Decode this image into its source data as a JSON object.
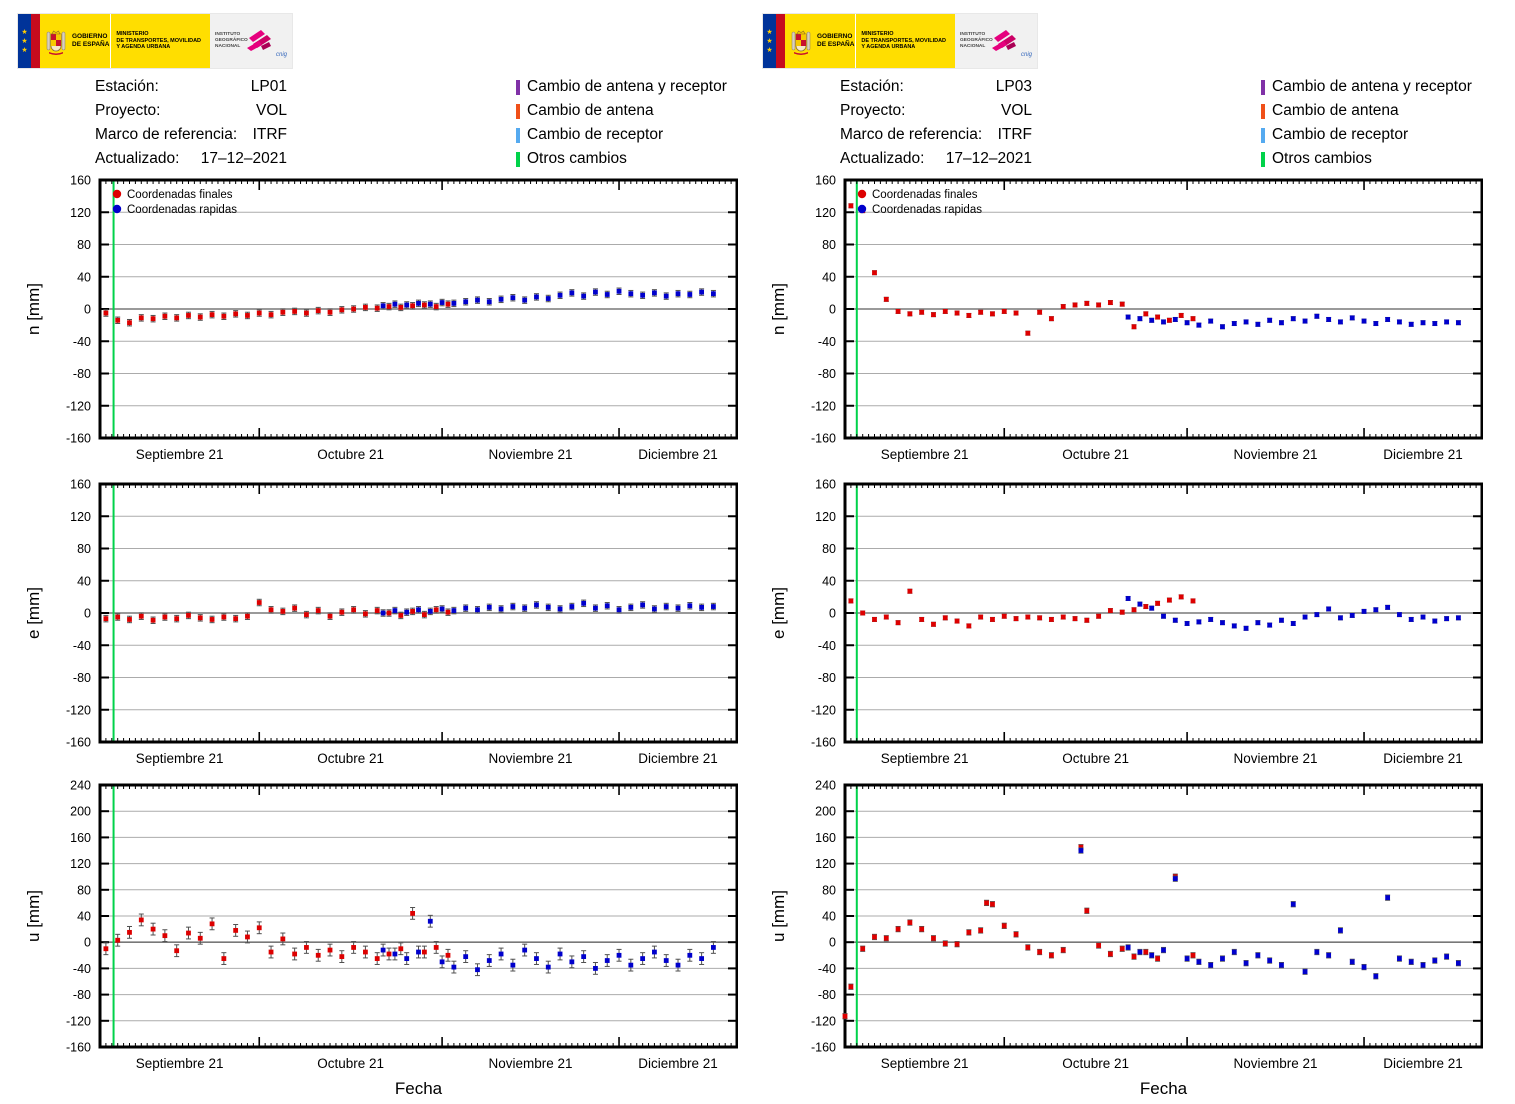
{
  "logo": {
    "gov_line1": "GOBIERNO",
    "gov_line2": "DE ESPAÑA",
    "ministry_line1": "MINISTERIO",
    "ministry_line2": "DE TRANSPORTES, MOVILIDAD",
    "ministry_line3": "Y AGENDA URBANA",
    "ign_line1": "INSTITUTO",
    "ign_line2": "GEOGRÁFICO",
    "ign_line3": "NACIONAL",
    "cnig": "cnig"
  },
  "columns": [
    {
      "station_label": "Estación:",
      "station": "LP01",
      "project_label": "Proyecto:",
      "project": "VOL",
      "frame_label": "Marco de referencia:",
      "frame": "ITRF",
      "updated_label": "Actualizado:",
      "updated": "17–12–2021"
    },
    {
      "station_label": "Estación:",
      "station": "LP03",
      "project_label": "Proyecto:",
      "project": "VOL",
      "frame_label": "Marco de referencia:",
      "frame": "ITRF",
      "updated_label": "Actualizado:",
      "updated": "17–12–2021"
    }
  ],
  "event_legend": [
    {
      "label": "Cambio de antena y receptor",
      "color": "#8031a7"
    },
    {
      "label": "Cambio de antena",
      "color": "#f05019"
    },
    {
      "label": "Cambio de receptor",
      "color": "#55aaf0"
    },
    {
      "label": "Otros cambios",
      "color": "#00d24a"
    }
  ],
  "series_legend": [
    {
      "label": "Coordenadas finales",
      "color": "#dd0000"
    },
    {
      "label": "Coordenadas rapidas",
      "color": "#0000cc"
    }
  ],
  "xaxis": {
    "label": "Fecha",
    "xlim": [
      3,
      111
    ],
    "month_starts": [
      30,
      61,
      91
    ],
    "months": [
      {
        "label": "Septiembre 21",
        "start": 0,
        "end": 30
      },
      {
        "label": "Octubre 21",
        "start": 30,
        "end": 61
      },
      {
        "label": "Noviembre 21",
        "start": 61,
        "end": 91
      },
      {
        "label": "Diciembre 21",
        "start": 91,
        "end": 112
      }
    ]
  },
  "chart_data": [
    {
      "type": "scatter",
      "station": "LP01",
      "component": "n",
      "ylabel": "n [mm]",
      "ylim": [
        -160,
        160
      ],
      "ytick_step": 40,
      "grid": true,
      "show_series_legend": true,
      "event_lines": [
        {
          "day": 5.3,
          "color": "#00d24a"
        }
      ],
      "series": [
        {
          "name": "Coordenadas finales",
          "color": "#dd0000",
          "err": 4,
          "x": [
            4,
            6,
            8,
            10,
            12,
            14,
            16,
            18,
            20,
            22,
            24,
            26,
            28,
            30,
            32,
            34,
            36,
            38,
            40,
            42,
            44,
            46,
            48,
            50,
            52,
            54,
            56,
            58,
            60,
            62
          ],
          "y": [
            -5,
            -14,
            -17,
            -11,
            -12,
            -9,
            -11,
            -8,
            -10,
            -7,
            -9,
            -6,
            -8,
            -5,
            -7,
            -4,
            -3,
            -5,
            -2,
            -4,
            -1,
            0,
            2,
            1,
            3,
            2,
            4,
            5,
            3,
            6
          ]
        },
        {
          "name": "Coordenadas rapidas",
          "color": "#0000cc",
          "err": 4,
          "x": [
            51,
            53,
            55,
            57,
            59,
            61,
            63,
            65,
            67,
            69,
            71,
            73,
            75,
            77,
            79,
            81,
            83,
            85,
            87,
            89,
            91,
            93,
            95,
            97,
            99,
            101,
            103,
            105,
            107
          ],
          "y": [
            4,
            6,
            5,
            7,
            6,
            8,
            7,
            9,
            11,
            9,
            12,
            14,
            11,
            15,
            13,
            17,
            20,
            16,
            21,
            18,
            22,
            19,
            17,
            20,
            16,
            19,
            18,
            21,
            19
          ]
        }
      ]
    },
    {
      "type": "scatter",
      "station": "LP01",
      "component": "e",
      "ylabel": "e [mm]",
      "ylim": [
        -160,
        160
      ],
      "ytick_step": 40,
      "grid": true,
      "show_series_legend": false,
      "event_lines": [
        {
          "day": 5.3,
          "color": "#00d24a"
        }
      ],
      "series": [
        {
          "name": "Coordenadas finales",
          "color": "#dd0000",
          "err": 4,
          "x": [
            4,
            6,
            8,
            10,
            12,
            14,
            16,
            18,
            20,
            22,
            24,
            26,
            28,
            30,
            32,
            34,
            36,
            38,
            40,
            42,
            44,
            46,
            48,
            50,
            52,
            54,
            56,
            58,
            60,
            62
          ],
          "y": [
            -7,
            -5,
            -8,
            -4,
            -9,
            -5,
            -7,
            -3,
            -6,
            -8,
            -5,
            -7,
            -4,
            13,
            4,
            2,
            6,
            -2,
            3,
            -4,
            1,
            4,
            -1,
            3,
            0,
            -3,
            2,
            -2,
            4,
            1
          ]
        },
        {
          "name": "Coordenadas rapidas",
          "color": "#0000cc",
          "err": 4,
          "x": [
            51,
            53,
            55,
            57,
            59,
            61,
            63,
            65,
            67,
            69,
            71,
            73,
            75,
            77,
            79,
            81,
            83,
            85,
            87,
            89,
            91,
            93,
            95,
            97,
            99,
            101,
            103,
            105,
            107
          ],
          "y": [
            0,
            3,
            1,
            4,
            2,
            5,
            3,
            6,
            4,
            7,
            5,
            8,
            6,
            10,
            7,
            5,
            8,
            12,
            6,
            9,
            4,
            7,
            10,
            5,
            8,
            6,
            9,
            7,
            8
          ]
        }
      ]
    },
    {
      "type": "scatter",
      "station": "LP01",
      "component": "u",
      "ylabel": "u [mm]",
      "xlabel": "Fecha",
      "ylim": [
        -160,
        240
      ],
      "ytick_step": 40,
      "grid": true,
      "show_series_legend": false,
      "event_lines": [
        {
          "day": 5.3,
          "color": "#00d24a"
        }
      ],
      "series": [
        {
          "name": "Coordenadas finales",
          "color": "#dd0000",
          "err": 9,
          "x": [
            4,
            6,
            8,
            10,
            12,
            14,
            16,
            18,
            20,
            22,
            24,
            26,
            28,
            30,
            32,
            34,
            36,
            38,
            40,
            42,
            44,
            46,
            48,
            50,
            52,
            54,
            56,
            58,
            60,
            62
          ],
          "y": [
            -10,
            3,
            15,
            34,
            20,
            10,
            -13,
            14,
            6,
            28,
            -25,
            18,
            8,
            22,
            -15,
            5,
            -18,
            -8,
            -20,
            -12,
            -22,
            -8,
            -15,
            -25,
            -18,
            -10,
            44,
            -15,
            -8,
            -20
          ]
        },
        {
          "name": "Coordenadas rapidas",
          "color": "#0000cc",
          "err": 9,
          "x": [
            51,
            53,
            55,
            57,
            59,
            61,
            63,
            65,
            67,
            69,
            71,
            73,
            75,
            77,
            79,
            81,
            83,
            85,
            87,
            89,
            91,
            93,
            95,
            97,
            99,
            101,
            103,
            105,
            107
          ],
          "y": [
            -12,
            -18,
            -25,
            -15,
            32,
            -30,
            -38,
            -22,
            -42,
            -28,
            -18,
            -35,
            -12,
            -25,
            -38,
            -18,
            -30,
            -22,
            -40,
            -28,
            -20,
            -35,
            -25,
            -15,
            -28,
            -35,
            -20,
            -25,
            -8
          ]
        }
      ]
    },
    {
      "type": "scatter",
      "station": "LP03",
      "component": "n",
      "ylabel": "n [mm]",
      "ylim": [
        -160,
        160
      ],
      "ytick_step": 40,
      "grid": true,
      "show_series_legend": true,
      "event_lines": [
        {
          "day": 5.0,
          "color": "#00d24a"
        }
      ],
      "series": [
        {
          "name": "Coordenadas finales",
          "color": "#dd0000",
          "err": 2.5,
          "x": [
            4,
            6,
            8,
            10,
            12,
            14,
            16,
            18,
            20,
            22,
            24,
            26,
            28,
            30,
            32,
            34,
            36,
            38,
            40,
            42,
            44,
            46,
            48,
            50,
            52,
            54,
            56,
            58,
            60,
            62
          ],
          "y": [
            128,
            122,
            45,
            12,
            -3,
            -6,
            -4,
            -7,
            -3,
            -5,
            -8,
            -4,
            -6,
            -3,
            -5,
            -30,
            -4,
            -12,
            3,
            5,
            7,
            5,
            8,
            6,
            -22,
            -6,
            -10,
            -14,
            -8,
            -12
          ]
        },
        {
          "name": "Coordenadas rapidas",
          "color": "#0000cc",
          "err": 2.5,
          "x": [
            51,
            53,
            55,
            57,
            59,
            61,
            63,
            65,
            67,
            69,
            71,
            73,
            75,
            77,
            79,
            81,
            83,
            85,
            87,
            89,
            91,
            93,
            95,
            97,
            99,
            101,
            103,
            105,
            107
          ],
          "y": [
            -10,
            -12,
            -14,
            -16,
            -13,
            -17,
            -20,
            -15,
            -22,
            -18,
            -16,
            -19,
            -14,
            -17,
            -12,
            -15,
            -9,
            -13,
            -16,
            -11,
            -15,
            -18,
            -13,
            -16,
            -19,
            -17,
            -18,
            -16,
            -17
          ]
        }
      ]
    },
    {
      "type": "scatter",
      "station": "LP03",
      "component": "e",
      "ylabel": "e [mm]",
      "ylim": [
        -160,
        160
      ],
      "ytick_step": 40,
      "grid": true,
      "show_series_legend": false,
      "event_lines": [
        {
          "day": 5.0,
          "color": "#00d24a"
        }
      ],
      "series": [
        {
          "name": "Coordenadas finales",
          "color": "#dd0000",
          "err": 2.5,
          "x": [
            4,
            6,
            8,
            10,
            12,
            14,
            16,
            18,
            20,
            22,
            24,
            26,
            28,
            30,
            32,
            34,
            36,
            38,
            40,
            42,
            44,
            46,
            48,
            50,
            52,
            54,
            56,
            58,
            60,
            62
          ],
          "y": [
            15,
            0,
            -8,
            -5,
            -12,
            27,
            -8,
            -14,
            -6,
            -10,
            -16,
            -5,
            -8,
            -4,
            -7,
            -5,
            -6,
            -8,
            -5,
            -7,
            -9,
            -4,
            3,
            1,
            4,
            8,
            12,
            16,
            20,
            15
          ]
        },
        {
          "name": "Coordenadas rapidas",
          "color": "#0000cc",
          "err": 2.5,
          "x": [
            51,
            53,
            55,
            57,
            59,
            61,
            63,
            65,
            67,
            69,
            71,
            73,
            75,
            77,
            79,
            81,
            83,
            85,
            87,
            89,
            91,
            93,
            95,
            97,
            99,
            101,
            103,
            105,
            107
          ],
          "y": [
            18,
            11,
            6,
            -4,
            -9,
            -13,
            -11,
            -8,
            -12,
            -16,
            -19,
            -12,
            -15,
            -9,
            -13,
            -5,
            -2,
            5,
            -6,
            -3,
            2,
            4,
            7,
            -2,
            -8,
            -5,
            -10,
            -7,
            -6
          ]
        }
      ]
    },
    {
      "type": "scatter",
      "station": "LP03",
      "component": "u",
      "ylabel": "u [mm]",
      "xlabel": "Fecha",
      "ylim": [
        -160,
        240
      ],
      "ytick_step": 40,
      "grid": true,
      "show_series_legend": false,
      "event_lines": [
        {
          "day": 5.0,
          "color": "#00d24a"
        }
      ],
      "series": [
        {
          "name": "Coordenadas finales",
          "color": "#dd0000",
          "err": 4,
          "x": [
            3,
            4,
            6,
            8,
            10,
            12,
            14,
            16,
            18,
            20,
            22,
            24,
            26,
            27,
            28,
            30,
            32,
            34,
            36,
            38,
            40,
            43,
            44,
            46,
            48,
            50,
            52,
            54,
            56,
            59,
            62
          ],
          "y": [
            -113,
            -68,
            -10,
            8,
            6,
            20,
            30,
            20,
            6,
            -2,
            -3,
            15,
            18,
            60,
            58,
            25,
            12,
            -8,
            -15,
            -20,
            -12,
            145,
            48,
            -5,
            -18,
            -10,
            -22,
            -15,
            -25,
            100,
            -20
          ]
        },
        {
          "name": "Coordenadas rapidas",
          "color": "#0000cc",
          "err": 4,
          "x": [
            43,
            51,
            53,
            55,
            57,
            59,
            61,
            63,
            65,
            67,
            69,
            71,
            73,
            75,
            77,
            79,
            81,
            83,
            85,
            87,
            89,
            91,
            93,
            95,
            97,
            99,
            101,
            103,
            105,
            107
          ],
          "y": [
            140,
            -8,
            -15,
            -20,
            -12,
            97,
            -25,
            -30,
            -35,
            -25,
            -15,
            -32,
            -20,
            -28,
            -35,
            58,
            -45,
            -15,
            -20,
            18,
            -30,
            -38,
            -52,
            68,
            -25,
            -30,
            -35,
            -28,
            -22,
            -32
          ]
        }
      ]
    }
  ]
}
